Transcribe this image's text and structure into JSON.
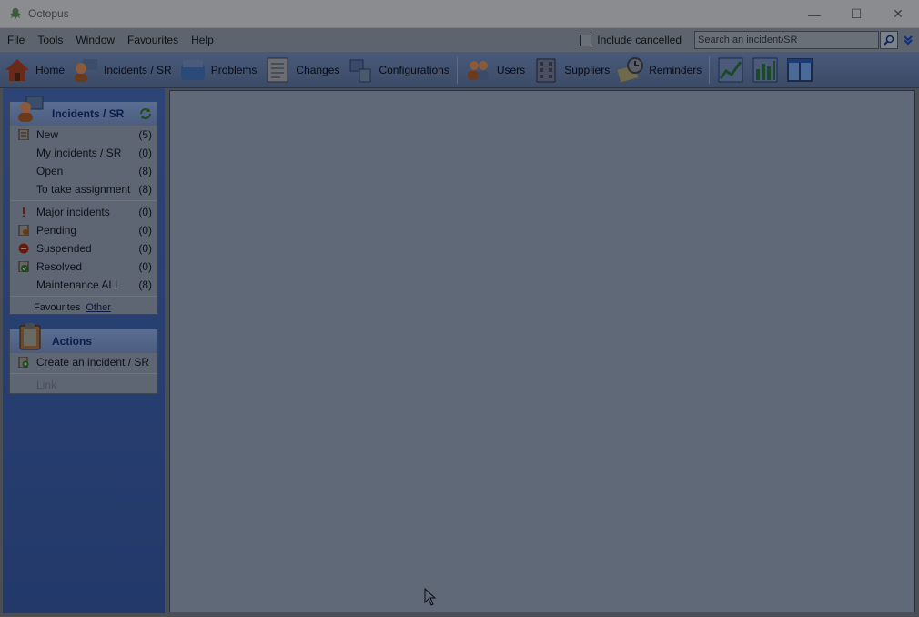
{
  "window": {
    "title": "Octopus",
    "app_icon": "octopus-icon",
    "min": "—",
    "max": "☐",
    "close": "✕"
  },
  "menu": [
    "File",
    "Tools",
    "Window",
    "Favourites",
    "Help"
  ],
  "search": {
    "include_cancelled_label": "Include cancelled",
    "placeholder": "Search an incident/SR"
  },
  "toolbar": [
    {
      "label": "Home",
      "icon": "home-icon"
    },
    {
      "label": "Incidents / SR",
      "icon": "incidents-icon"
    },
    {
      "label": "Problems",
      "icon": "problems-icon"
    },
    {
      "label": "Changes",
      "icon": "changes-icon"
    },
    {
      "label": "Configurations",
      "icon": "configurations-icon"
    },
    {
      "label": "Users",
      "icon": "users-icon"
    },
    {
      "label": "Suppliers",
      "icon": "suppliers-icon"
    },
    {
      "label": "Reminders",
      "icon": "reminders-icon"
    }
  ],
  "incidents_panel": {
    "title": "Incidents / SR",
    "items": [
      {
        "label": "New",
        "count": "(5)",
        "icon": "new-doc-icon"
      },
      {
        "label": "My incidents / SR",
        "count": "(0)",
        "icon": ""
      },
      {
        "label": "Open",
        "count": "(8)",
        "icon": ""
      },
      {
        "label": "To take assignment",
        "count": "(8)",
        "icon": ""
      }
    ],
    "items2": [
      {
        "label": "Major incidents",
        "count": "(0)",
        "icon": "major-icon"
      },
      {
        "label": "Pending",
        "count": "(0)",
        "icon": "pending-icon"
      },
      {
        "label": "Suspended",
        "count": "(0)",
        "icon": "suspended-icon"
      },
      {
        "label": "Resolved",
        "count": "(0)",
        "icon": "resolved-icon"
      },
      {
        "label": "Maintenance ALL",
        "count": "(8)",
        "icon": ""
      }
    ],
    "favourites_label": "Favourites",
    "other_label": "Other"
  },
  "actions_panel": {
    "title": "Actions",
    "create_label": "Create an incident / SR",
    "link_label": "Link"
  }
}
